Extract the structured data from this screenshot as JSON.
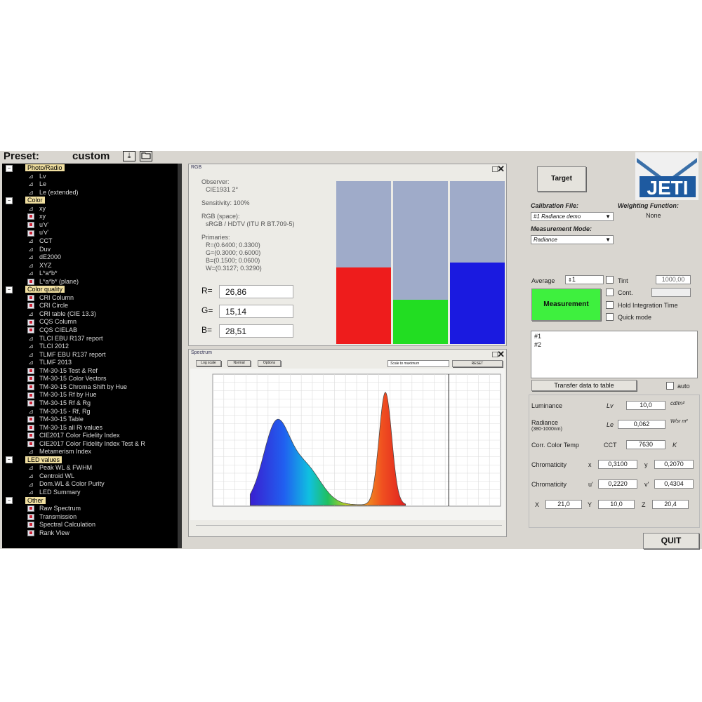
{
  "preset": {
    "label": "Preset:",
    "value": "custom",
    "save_icon": "⤓"
  },
  "tree": [
    {
      "kind": "group",
      "label": "Photo/Radio"
    },
    {
      "kind": "item",
      "icon": "graph",
      "label": "Lv"
    },
    {
      "kind": "item",
      "icon": "graph",
      "label": "Le"
    },
    {
      "kind": "item",
      "icon": "graph",
      "label": "Le (extended)"
    },
    {
      "kind": "group",
      "label": "Color"
    },
    {
      "kind": "item",
      "icon": "graph",
      "label": "xy"
    },
    {
      "kind": "item",
      "icon": "check",
      "label": "xy"
    },
    {
      "kind": "item",
      "icon": "check",
      "label": "u'v'"
    },
    {
      "kind": "item",
      "icon": "check",
      "label": "u'v'"
    },
    {
      "kind": "item",
      "icon": "graph",
      "label": "CCT"
    },
    {
      "kind": "item",
      "icon": "graph",
      "label": "Duv"
    },
    {
      "kind": "item",
      "icon": "graph",
      "label": "dE2000"
    },
    {
      "kind": "item",
      "icon": "graph",
      "label": "XYZ"
    },
    {
      "kind": "item",
      "icon": "graph",
      "label": "L*a*b*"
    },
    {
      "kind": "item",
      "icon": "check",
      "label": "L*a*b* (plane)"
    },
    {
      "kind": "group",
      "label": "Color quality"
    },
    {
      "kind": "item",
      "icon": "check",
      "label": "CRI Column"
    },
    {
      "kind": "item",
      "icon": "check",
      "label": "CRI Circle"
    },
    {
      "kind": "item",
      "icon": "graph",
      "label": "CRI table (CIE 13.3)"
    },
    {
      "kind": "item",
      "icon": "check",
      "label": "CQS Column"
    },
    {
      "kind": "item",
      "icon": "check",
      "label": "CQS CIELAB"
    },
    {
      "kind": "item",
      "icon": "graph",
      "label": "TLCI EBU R137 report"
    },
    {
      "kind": "item",
      "icon": "graph",
      "label": "TLCI 2012"
    },
    {
      "kind": "item",
      "icon": "graph",
      "label": "TLMF EBU R137 report"
    },
    {
      "kind": "item",
      "icon": "graph",
      "label": "TLMF 2013"
    },
    {
      "kind": "item",
      "icon": "check",
      "label": "TM-30-15 Test & Ref"
    },
    {
      "kind": "item",
      "icon": "check",
      "label": "TM-30-15 Color Vectors"
    },
    {
      "kind": "item",
      "icon": "check",
      "label": "TM-30-15 Chroma Shift by Hue"
    },
    {
      "kind": "item",
      "icon": "check",
      "label": "TM-30-15 Rf by Hue"
    },
    {
      "kind": "item",
      "icon": "check",
      "label": "TM-30-15 Rf & Rg"
    },
    {
      "kind": "item",
      "icon": "graph",
      "label": "TM-30-15 - Rf, Rg"
    },
    {
      "kind": "item",
      "icon": "check",
      "label": "TM-30-15 Table"
    },
    {
      "kind": "item",
      "icon": "check",
      "label": "TM-30-15 all Ri values"
    },
    {
      "kind": "item",
      "icon": "check",
      "label": "CIE2017 Color Fidelity Index"
    },
    {
      "kind": "item",
      "icon": "check",
      "label": "CIE2017 Color Fidelity Index Test & R"
    },
    {
      "kind": "item",
      "icon": "graph",
      "label": "Metamerism Index"
    },
    {
      "kind": "group",
      "label": "LED values"
    },
    {
      "kind": "item",
      "icon": "graph",
      "label": "Peak WL & FWHM"
    },
    {
      "kind": "item",
      "icon": "graph",
      "label": "Centroid WL"
    },
    {
      "kind": "item",
      "icon": "graph",
      "label": "Dom.WL & Color Purity"
    },
    {
      "kind": "item",
      "icon": "graph",
      "label": "LED Summary"
    },
    {
      "kind": "group",
      "label": "Other"
    },
    {
      "kind": "item",
      "icon": "check",
      "label": "Raw Spectrum"
    },
    {
      "kind": "item",
      "icon": "check",
      "label": "Transmission"
    },
    {
      "kind": "item",
      "icon": "check",
      "label": "Spectral Calculation"
    },
    {
      "kind": "item",
      "icon": "check",
      "label": "Rank View"
    }
  ],
  "rgb_panel": {
    "title": "RGB",
    "observer_label": "Observer:",
    "observer_value": "CIE1931 2°",
    "sensitivity": "Sensitivity: 100%",
    "space_label": "RGB (space):",
    "space_value": "sRGB / HDTV (ITU R BT.709-5)",
    "primaries_label": "Primaries:",
    "primaries": [
      "R=(0.6400; 0.3300)",
      "G=(0.3000; 0.6000)",
      "B=(0.1500; 0.0600)",
      "W=(0.3127; 0.3290)"
    ],
    "values": [
      {
        "label": "R=",
        "value": "26,86",
        "fraction": 0.47,
        "color": "#ee1c1c"
      },
      {
        "label": "G=",
        "value": "15,14",
        "fraction": 0.27,
        "color": "#22dd22"
      },
      {
        "label": "B=",
        "value": "28,51",
        "fraction": 0.5,
        "color": "#1a1ae0"
      }
    ],
    "bar_bg": "#9fabc9"
  },
  "spectrum_panel": {
    "title": "Spectrum",
    "buttons": [
      "Log scale",
      "Normal",
      "Options"
    ],
    "scale_select": "Scale to maximum",
    "reset_label": "RESET"
  },
  "right": {
    "target_label": "Target",
    "calibration_label": "Calibration File:",
    "calibration_value": "#1 Radiance demo",
    "weighting_label": "Weighting Function:",
    "weighting_value": "None",
    "mode_label": "Measurement Mode:",
    "mode_value": "Radiance",
    "average_label": "Average",
    "average_value": "1",
    "tint_label": "Tint",
    "tint_value": "1000,00",
    "cont_label": "Cont.",
    "measurement_label": "Measurement",
    "hold_label": "Hold Integration Time",
    "quick_label": "Quick mode",
    "list_items": [
      "#1",
      "#2"
    ],
    "transfer_label": "Transfer data to table",
    "auto_label": "auto",
    "luminance_label": "Luminance",
    "luminance_symbol": "Lv",
    "luminance_value": "10,0",
    "luminance_unit": "cd/m²",
    "radiance_label": "Radiance",
    "radiance_range": "(380-1000nm)",
    "radiance_symbol": "Le",
    "radiance_value": "0,062",
    "radiance_unit": "W/sr m²",
    "cct_label": "Corr. Color Temp",
    "cct_symbol": "CCT",
    "cct_value": "7630",
    "cct_unit": "K",
    "chroma1_label": "Chromaticity",
    "x_label": "x",
    "x_value": "0,3100",
    "y_label": "y",
    "y_value": "0,2070",
    "chroma2_label": "Chromaticity",
    "u_label": "u'",
    "u_value": "0,2220",
    "v_label": "v'",
    "v_value": "0,4304",
    "X_label": "X",
    "X_value": "21,0",
    "Y_label": "Y",
    "Y_value": "10,0",
    "Z_label": "Z",
    "Z_value": "20,4",
    "quit_label": "QUIT",
    "measure_color": "#3ef03e"
  }
}
